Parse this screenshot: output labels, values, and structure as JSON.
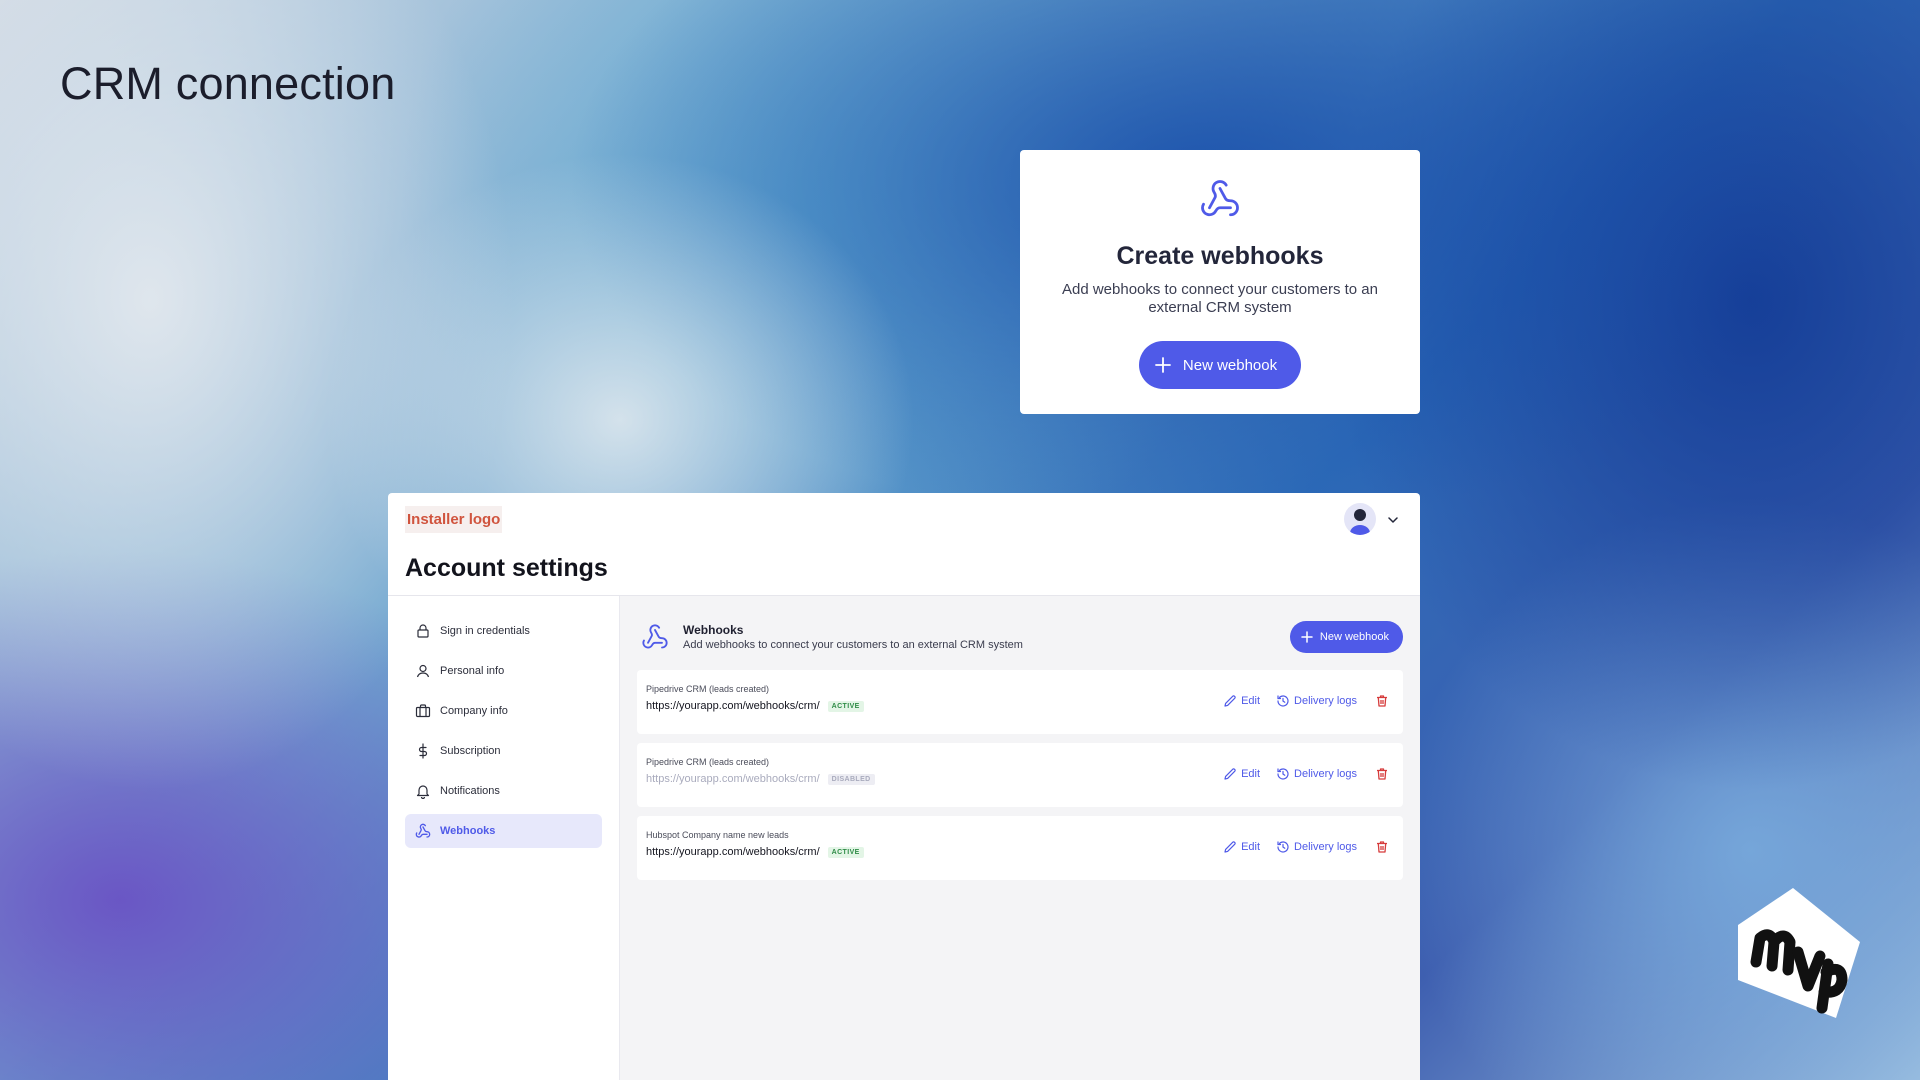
{
  "slide": {
    "title": "CRM connection"
  },
  "create_card": {
    "title": "Create webhooks",
    "description": "Add webhooks to connect your customers to an external CRM system",
    "button_label": "New webhook"
  },
  "app": {
    "logo_text": "Installer logo",
    "title": "Account settings",
    "sidebar": {
      "items": [
        {
          "label": "Sign in credentials",
          "icon": "lock-icon"
        },
        {
          "label": "Personal info",
          "icon": "user-icon"
        },
        {
          "label": "Company info",
          "icon": "briefcase-icon"
        },
        {
          "label": "Subscription",
          "icon": "dollar-icon"
        },
        {
          "label": "Notifications",
          "icon": "bell-icon"
        },
        {
          "label": "Webhooks",
          "icon": "webhook-icon",
          "active": true
        }
      ]
    },
    "main": {
      "heading": "Webhooks",
      "subheading": "Add webhooks to connect your customers to an external CRM system",
      "new_button_label": "New webhook",
      "actions": {
        "edit": "Edit",
        "logs": "Delivery logs"
      },
      "webhooks": [
        {
          "name": "Pipedrive CRM (leads created)",
          "url": "https://yourapp.com/webhooks/crm/",
          "status": "ACTIVE"
        },
        {
          "name": "Pipedrive CRM (leads created)",
          "url": "https://yourapp.com/webhooks/crm/",
          "status": "DISABLED"
        },
        {
          "name": "Hubspot Company name new leads",
          "url": "https://yourapp.com/webhooks/crm/",
          "status": "ACTIVE"
        }
      ]
    }
  },
  "brand_logo": "mvp",
  "colors": {
    "accent": "#4f5ae8",
    "active_badge": "#2f8c47",
    "danger": "#d63b3b",
    "logo_text": "#d0543e"
  }
}
